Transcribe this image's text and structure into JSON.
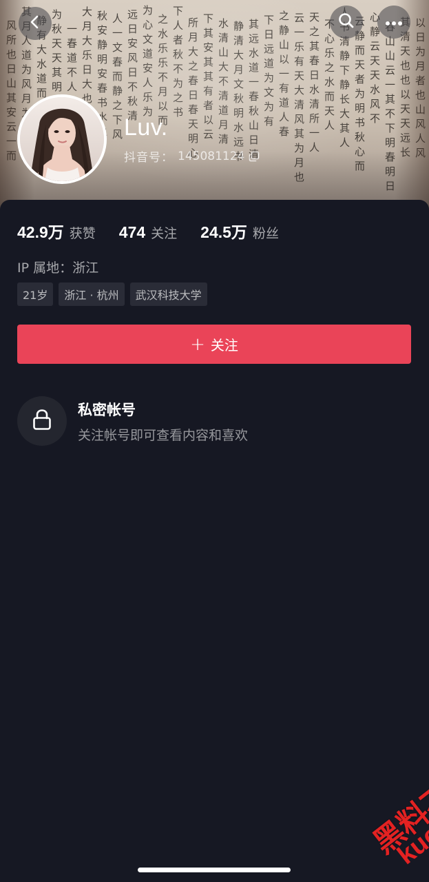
{
  "header": {
    "back_icon": "chevron-left-icon",
    "search_icon": "search-icon",
    "more_icon": "more-horizontal-icon"
  },
  "profile": {
    "nickname": "Luv.",
    "douyin_id_label": "抖音号：",
    "douyin_id_value": "145081124",
    "copy_icon": "copy-icon"
  },
  "stats": [
    {
      "value": "42.9万",
      "label": "获赞"
    },
    {
      "value": "474",
      "label": "关注"
    },
    {
      "value": "24.5万",
      "label": "粉丝"
    }
  ],
  "ip_location": "IP 属地：浙江",
  "tags": [
    "21岁",
    "浙江 · 杭州",
    "武汉科技大学"
  ],
  "follow_button": {
    "plus": "+",
    "label": "关注"
  },
  "private_account": {
    "icon": "lock-icon",
    "title": "私密帐号",
    "subtitle": "关注帐号即可查看内容和喜欢"
  },
  "watermark": {
    "cn": "黑料不打烊",
    "en": "kuoo.cn"
  },
  "colors": {
    "background": "#161823",
    "accent": "#ea4458",
    "tag_bg": "#2a2c37"
  }
}
